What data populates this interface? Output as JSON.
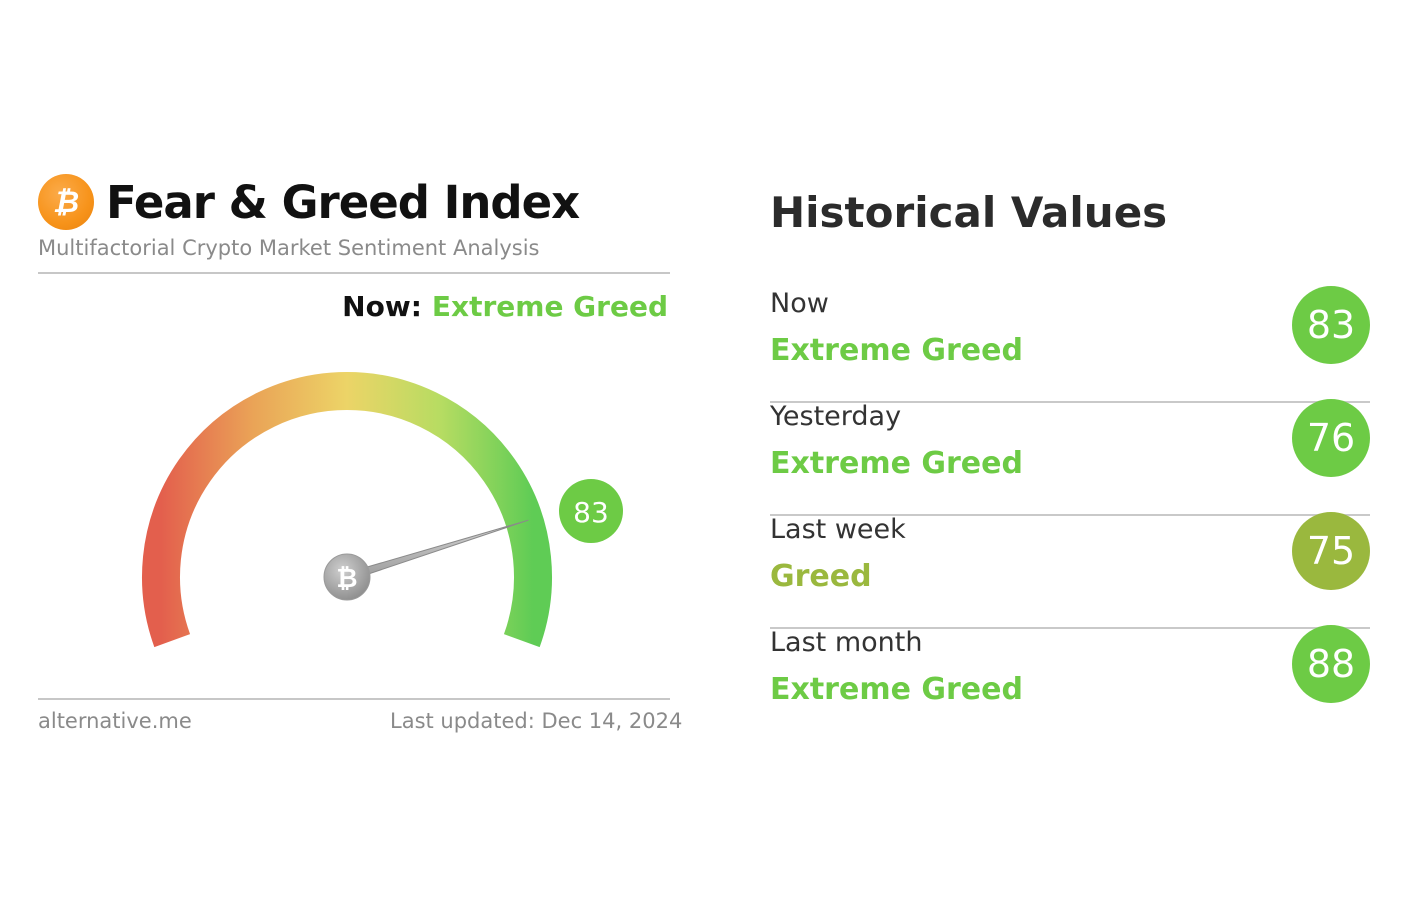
{
  "card": {
    "title": "Fear & Greed Index",
    "subtitle": "Multifactorial Crypto Market Sentiment Analysis",
    "now_label": "Now:",
    "now_value": "Extreme Greed",
    "gauge_value": 83,
    "gauge_badge": "83",
    "gauge_scale_max": 100,
    "footer_source": "alternative.me",
    "footer_updated": "Last updated: Dec 14, 2024",
    "logo_icon": "bitcoin-icon"
  },
  "historical": {
    "title": "Historical Values",
    "rows": [
      {
        "period": "Now",
        "classification": "Extreme Greed",
        "value": "83",
        "color": "#6dcb45"
      },
      {
        "period": "Yesterday",
        "classification": "Extreme Greed",
        "value": "76",
        "color": "#6dcb45"
      },
      {
        "period": "Last week",
        "classification": "Greed",
        "value": "75",
        "color": "#9ab83e"
      },
      {
        "period": "Last month",
        "classification": "Extreme Greed",
        "value": "88",
        "color": "#6dcb45"
      }
    ]
  },
  "colors": {
    "extreme_greed": "#6dcb45",
    "greed": "#9ab83e",
    "bitcoin_orange": "#f7931a"
  }
}
